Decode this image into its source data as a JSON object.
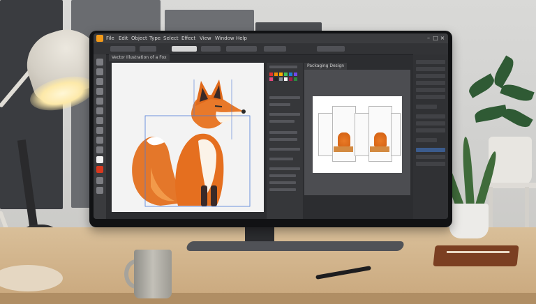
{
  "scene": {
    "description_free": true
  },
  "app": {
    "menu": [
      "File",
      "Edit",
      "Object",
      "Type",
      "Select",
      "Effect",
      "View",
      "Window",
      "Help"
    ],
    "document_tab": "Vector Illustration of a Fox",
    "second_document_tab": "Packaging Design",
    "window_controls": [
      "–",
      "□",
      "×"
    ]
  },
  "colors": {
    "accent_orange": "#f29a1a",
    "fox_orange": "#e97a26",
    "selection_blue": "#4d7bd6",
    "ui_dark": "#2c2d30",
    "layer_selected": "#3b5b8c"
  },
  "swatches": [
    "#e03131",
    "#f08c00",
    "#fab005",
    "#40c057",
    "#1c7ed6",
    "#7048e8",
    "#e64980",
    "#212529",
    "#868e96",
    "#f8f9fa",
    "#a61e4d",
    "#2b8a3e"
  ]
}
